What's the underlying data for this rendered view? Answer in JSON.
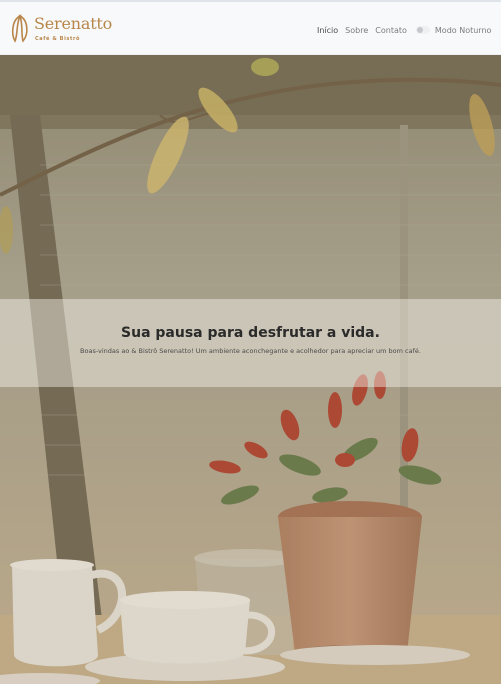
{
  "brand": {
    "name": "Serenatto",
    "tagline": "Café & Bistrô",
    "accent": "#b8864a"
  },
  "nav": {
    "items": [
      {
        "label": "Início",
        "active": true
      },
      {
        "label": "Sobre",
        "active": false
      },
      {
        "label": "Contato",
        "active": false
      }
    ],
    "dark_mode_label": "Modo Noturno",
    "dark_mode_on": false
  },
  "hero": {
    "title": "Sua pausa para desfrutar a vida.",
    "subtitle": "Boas-vindas ao & Bistrô Serenatto! Um ambiente aconchegante e acolhedor para apreciar um bom café.",
    "background_icon": "cafe-photo"
  }
}
